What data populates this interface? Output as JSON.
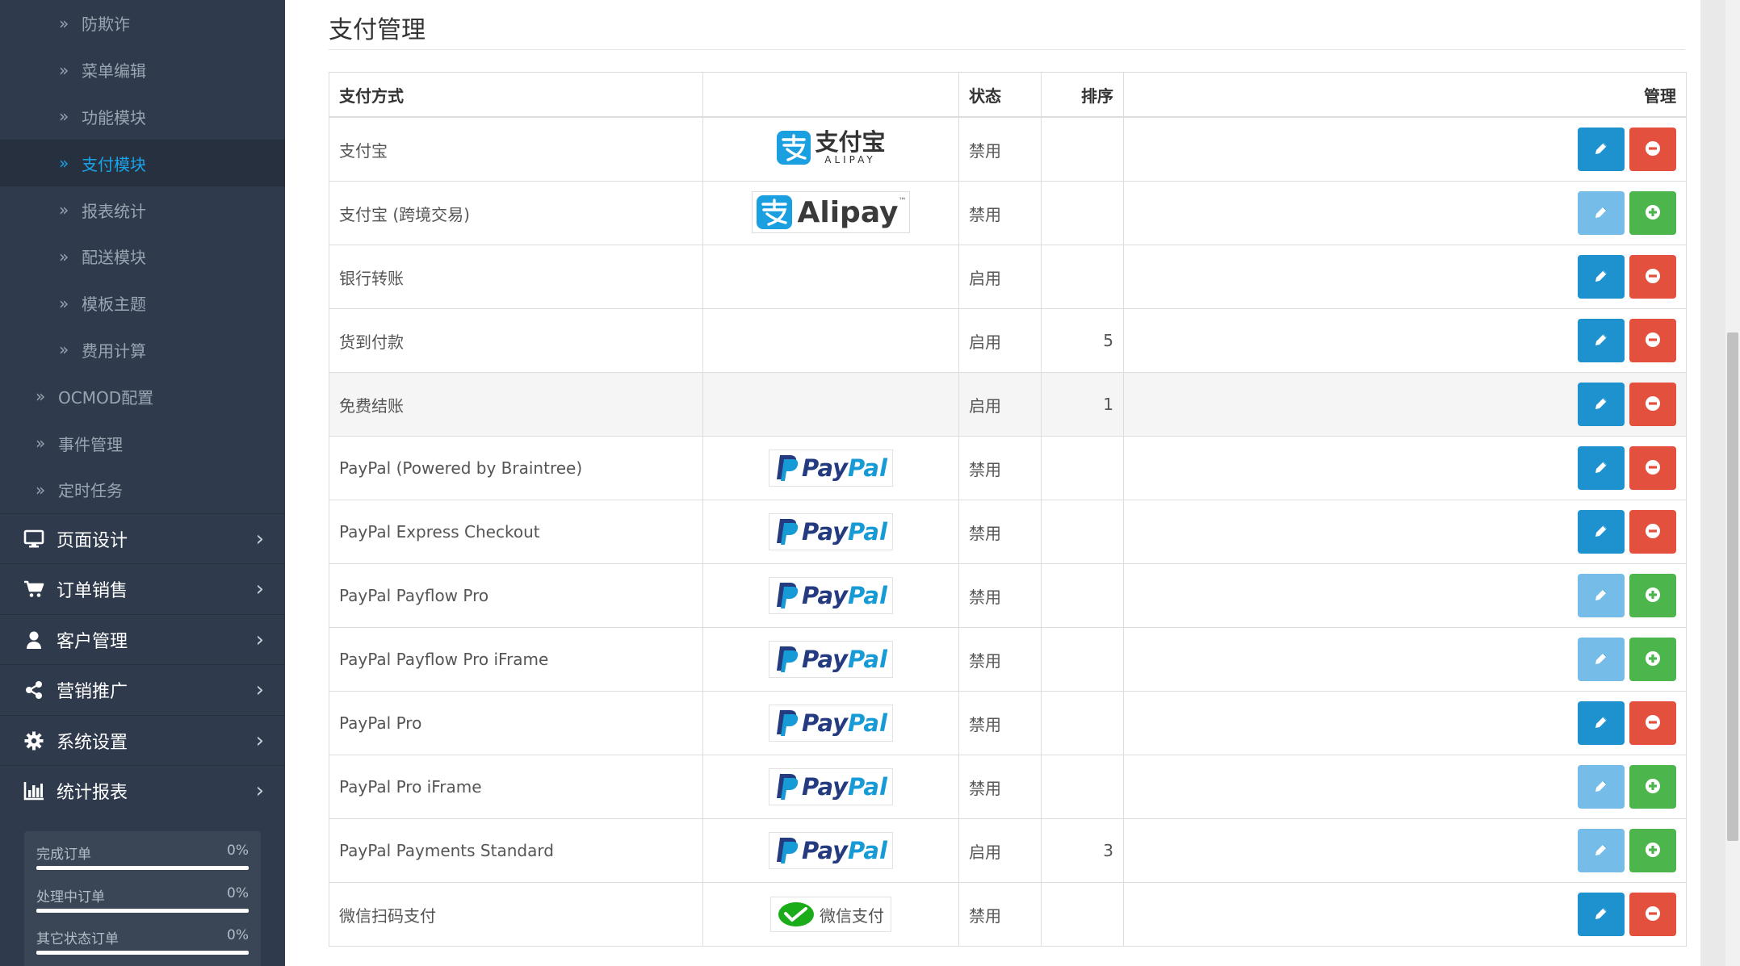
{
  "sidebar": {
    "sub_items": [
      {
        "label": "防欺诈",
        "level": 2,
        "active": false
      },
      {
        "label": "菜单编辑",
        "level": 2,
        "active": false
      },
      {
        "label": "功能模块",
        "level": 2,
        "active": false
      },
      {
        "label": "支付模块",
        "level": 2,
        "active": true
      },
      {
        "label": "报表统计",
        "level": 2,
        "active": false
      },
      {
        "label": "配送模块",
        "level": 2,
        "active": false
      },
      {
        "label": "模板主题",
        "level": 2,
        "active": false
      },
      {
        "label": "费用计算",
        "level": 2,
        "active": false
      },
      {
        "label": "OCMOD配置",
        "level": 1,
        "active": false
      },
      {
        "label": "事件管理",
        "level": 1,
        "active": false
      },
      {
        "label": "定时任务",
        "level": 1,
        "active": false
      }
    ],
    "chevron": "»",
    "main_items": [
      {
        "label": "页面设计",
        "icon": "desktop-icon"
      },
      {
        "label": "订单销售",
        "icon": "shopping-cart-icon"
      },
      {
        "label": "客户管理",
        "icon": "user-icon"
      },
      {
        "label": "营销推广",
        "icon": "share-icon"
      },
      {
        "label": "系统设置",
        "icon": "cog-icon"
      },
      {
        "label": "统计报表",
        "icon": "bar-chart-icon"
      }
    ],
    "arrow": "›",
    "stats": [
      {
        "label": "完成订单",
        "value": "0%",
        "progress": 0
      },
      {
        "label": "处理中订单",
        "value": "0%",
        "progress": 0
      },
      {
        "label": "其它状态订单",
        "value": "0%",
        "progress": 0
      }
    ]
  },
  "page": {
    "title": "支付管理",
    "columns": {
      "method": "支付方式",
      "logo": "",
      "status": "状态",
      "sort": "排序",
      "manage": "管理"
    }
  },
  "rows": [
    {
      "name": "支付宝",
      "logo": "alipay-cn",
      "status": "禁用",
      "sort": "",
      "installed": true
    },
    {
      "name": "支付宝 (跨境交易)",
      "logo": "alipay-en",
      "status": "禁用",
      "sort": "",
      "installed": false
    },
    {
      "name": "银行转账",
      "logo": "",
      "status": "启用",
      "sort": "",
      "installed": true
    },
    {
      "name": "货到付款",
      "logo": "",
      "status": "启用",
      "sort": "5",
      "installed": true
    },
    {
      "name": "免费结账",
      "logo": "",
      "status": "启用",
      "sort": "1",
      "installed": true
    },
    {
      "name": "PayPal (Powered by Braintree)",
      "logo": "paypal",
      "status": "禁用",
      "sort": "",
      "installed": true
    },
    {
      "name": "PayPal Express Checkout",
      "logo": "paypal",
      "status": "禁用",
      "sort": "",
      "installed": true
    },
    {
      "name": "PayPal Payflow Pro",
      "logo": "paypal",
      "status": "禁用",
      "sort": "",
      "installed": false
    },
    {
      "name": "PayPal Payflow Pro iFrame",
      "logo": "paypal",
      "status": "禁用",
      "sort": "",
      "installed": false
    },
    {
      "name": "PayPal Pro",
      "logo": "paypal",
      "status": "禁用",
      "sort": "",
      "installed": true
    },
    {
      "name": "PayPal Pro iFrame",
      "logo": "paypal",
      "status": "禁用",
      "sort": "",
      "installed": false
    },
    {
      "name": "PayPal Payments Standard",
      "logo": "paypal",
      "status": "启用",
      "sort": "3",
      "installed": false
    },
    {
      "name": "微信扫码支付",
      "logo": "wechat-pay",
      "status": "禁用",
      "sort": "",
      "installed": true
    }
  ],
  "logos": {
    "alipay_cn_text": "支付宝",
    "alipay_cn_sub": "ALIPAY",
    "alipay_en_text": "Alipay",
    "alipay_en_tm": "™",
    "paypal_pay": "Pay",
    "paypal_pal": "Pal",
    "wechat_text": "微信支付"
  },
  "colors": {
    "sidebar_bg": "#2f3b4c",
    "accent": "#1aa3e8",
    "edit_button": "#1e91cf",
    "edit_button_disabled": "#75bce8",
    "delete_button": "#e3503e",
    "install_button": "#4cb64c",
    "alipay_blue": "#1a9fe0",
    "paypal_dark": "#253b80",
    "paypal_light": "#179bd7",
    "wechat_green": "#1aad19"
  }
}
